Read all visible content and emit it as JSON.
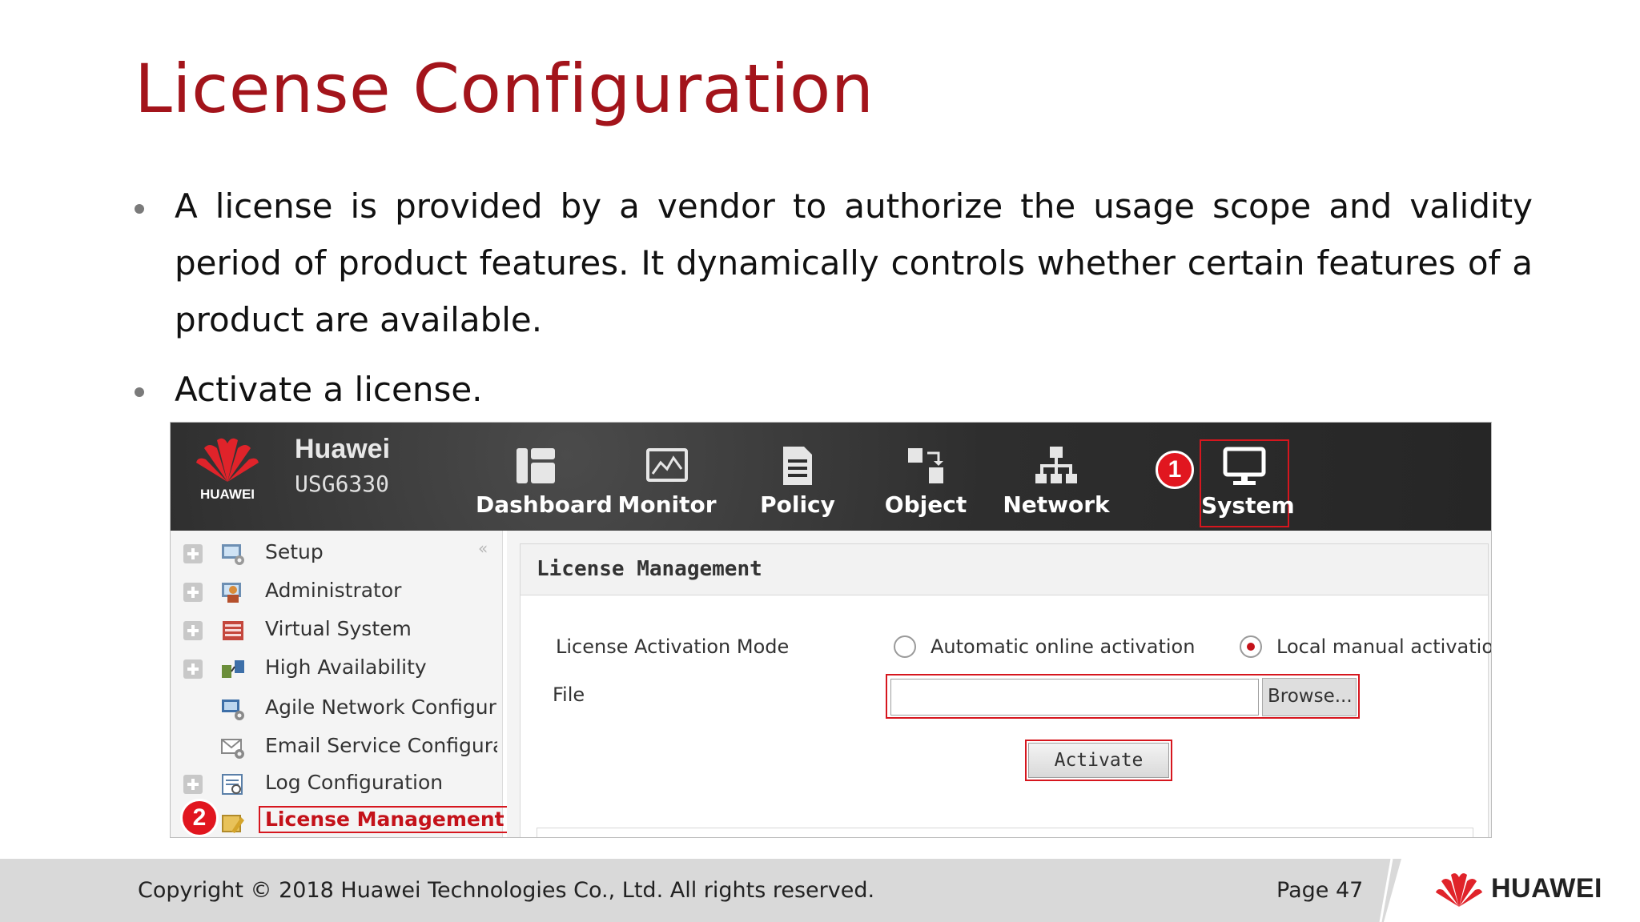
{
  "slide": {
    "title": "License Configuration",
    "bullets": [
      "A license is provided by a vendor to authorize the usage scope and validity period of product features. It dynamically controls whether certain features of a product are available.",
      "Activate a license."
    ]
  },
  "app": {
    "brand": "HUAWEI",
    "product_name": "Huawei",
    "product_model": "USG6330",
    "nav": [
      {
        "label": "Dashboard",
        "icon": "dashboard-icon"
      },
      {
        "label": "Monitor",
        "icon": "monitor-icon"
      },
      {
        "label": "Policy",
        "icon": "policy-icon"
      },
      {
        "label": "Object",
        "icon": "object-icon"
      },
      {
        "label": "Network",
        "icon": "network-icon"
      },
      {
        "label": "System",
        "icon": "system-icon",
        "selected": true
      }
    ],
    "step_badges": [
      "1",
      "2"
    ],
    "sidebar": {
      "collapse": "«",
      "items": [
        {
          "label": "Setup",
          "icon": "setup-icon",
          "expandable": true
        },
        {
          "label": "Administrator",
          "icon": "administrator-icon",
          "expandable": true
        },
        {
          "label": "Virtual System",
          "icon": "virtual-system-icon",
          "expandable": true
        },
        {
          "label": "High Availability",
          "icon": "high-availability-icon",
          "expandable": true
        },
        {
          "label": "Agile Network Configura",
          "icon": "agile-network-icon",
          "expandable": false
        },
        {
          "label": "Email Service Configura",
          "icon": "email-service-icon",
          "expandable": false
        },
        {
          "label": "Log Configuration",
          "icon": "log-configuration-icon",
          "expandable": true
        },
        {
          "label": "License Management",
          "icon": "license-icon",
          "expandable": false,
          "active": true
        }
      ]
    },
    "panel": {
      "title": "License Management",
      "mode_label": "License Activation Mode",
      "options": [
        {
          "label": "Automatic online activation",
          "checked": false
        },
        {
          "label": "Local manual activation",
          "checked": true
        }
      ],
      "file_label": "File",
      "file_value": "",
      "browse_label": "Browse...",
      "activate_label": "Activate"
    }
  },
  "footer": {
    "copyright": "Copyright © 2018 Huawei Technologies Co., Ltd. All rights reserved.",
    "page": "Page 47",
    "brand": "HUAWEI"
  },
  "colors": {
    "title": "#a3141b",
    "accent_red": "#d6161e",
    "topbar": "#2d2d2d",
    "footer": "#d9d9d9"
  }
}
